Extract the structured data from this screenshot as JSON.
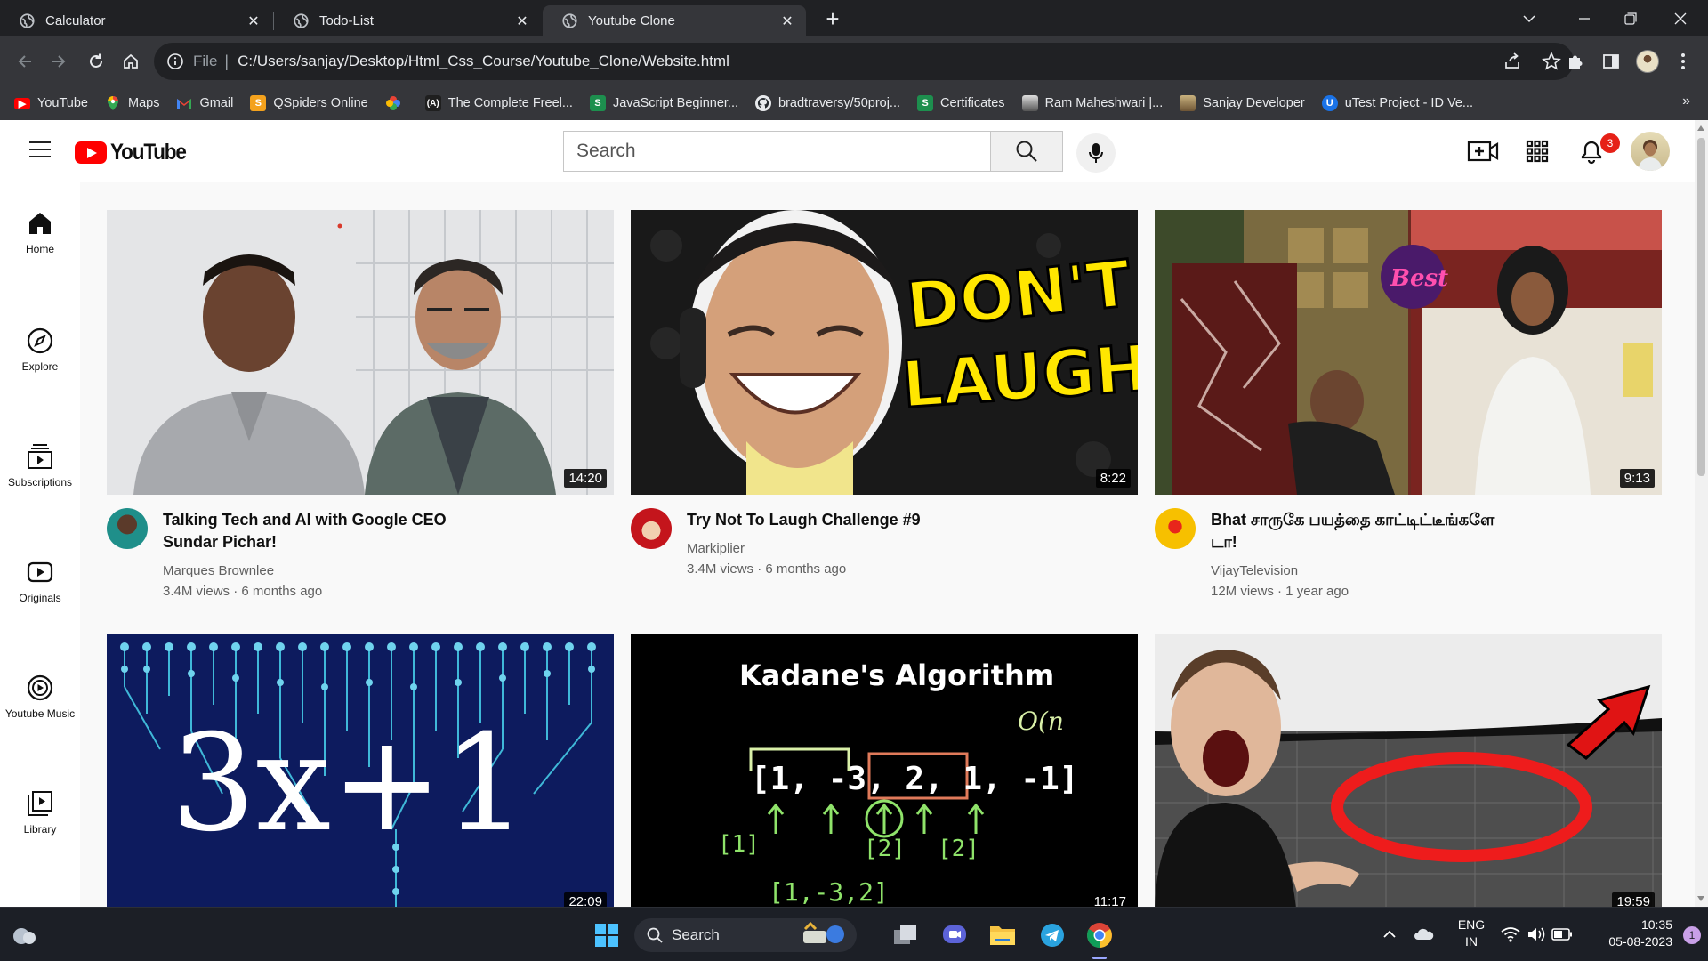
{
  "browser": {
    "tabs": [
      {
        "label": "Calculator",
        "active": false
      },
      {
        "label": "Todo-List",
        "active": false
      },
      {
        "label": "Youtube Clone",
        "active": true
      }
    ],
    "address": {
      "scheme_label": "File",
      "url": "C:/Users/sanjay/Desktop/Html_Css_Course/Youtube_Clone/Website.html"
    },
    "bookmarks": [
      {
        "label": "YouTube",
        "icon": "youtube-icon",
        "color": "#ff0000"
      },
      {
        "label": "Maps",
        "icon": "maps-icon",
        "color": "#34a853"
      },
      {
        "label": "Gmail",
        "icon": "gmail-icon",
        "color": "#ea4335"
      },
      {
        "label": "QSpiders Online",
        "icon": "qspiders-icon",
        "color": "#f4a21d"
      },
      {
        "label": "",
        "icon": "photos-icon",
        "color": "#fbbc04"
      },
      {
        "label": "The Complete Freel...",
        "icon": "freelance-icon",
        "color": "#1f1f1f"
      },
      {
        "label": "JavaScript Beginner...",
        "icon": "udemy-s-icon",
        "color": "#1d8f4e"
      },
      {
        "label": "bradtraversy/50proj...",
        "icon": "github-icon",
        "color": "#24292e"
      },
      {
        "label": "Certificates",
        "icon": "certificates-icon",
        "color": "#1d8f4e"
      },
      {
        "label": "Ram Maheshwari |...",
        "icon": "profile-icon",
        "color": "#6b6b6b"
      },
      {
        "label": "Sanjay Developer",
        "icon": "sanjay-icon",
        "color": "#8a6d4a"
      },
      {
        "label": "uTest Project - ID Ve...",
        "icon": "utest-icon",
        "color": "#1a73e8"
      }
    ],
    "more_label": "»"
  },
  "youtube": {
    "logo_text": "YouTube",
    "search_placeholder": "Search",
    "notification_count": "3",
    "sidebar": [
      {
        "label": "Home",
        "icon": "home-icon"
      },
      {
        "label": "Explore",
        "icon": "explore-icon"
      },
      {
        "label": "Subscriptions",
        "icon": "subscriptions-icon"
      },
      {
        "label": "Originals",
        "icon": "originals-icon"
      },
      {
        "label": "Youtube Music",
        "icon": "youtube-music-icon"
      },
      {
        "label": "Library",
        "icon": "library-icon"
      }
    ],
    "videos": [
      {
        "title": "Talking Tech and AI with Google CEO Sundar Pichar!",
        "channel": "Marques Brownlee",
        "meta": "3.4M views · 6 months ago",
        "duration": "14:20"
      },
      {
        "title": "Try Not To Laugh Challenge #9",
        "channel": "Markiplier",
        "meta": "3.4M views · 6 months ago",
        "duration": "8:22"
      },
      {
        "title": "Bhat சாருகே பயத்தை காட்டிட்டீங்களே டா!",
        "channel": "VijayTelevision",
        "meta": "12M views · 1 year ago",
        "duration": "9:13"
      },
      {
        "title": "",
        "channel": "",
        "meta": "",
        "duration": "22:09"
      },
      {
        "title": "",
        "channel": "",
        "meta": "",
        "duration": "11:17"
      },
      {
        "title": "",
        "channel": "",
        "meta": "",
        "duration": "19:59"
      }
    ],
    "thumb_text": {
      "laugh_line1": "DON'T",
      "laugh_line2": "LAUGH",
      "collatz": "3x+1",
      "kadane_title": "Kadane's Algorithm",
      "kadane_complexity": "O(n",
      "kadane_array": "[1, -3, 2, 1, -1]",
      "kadane_sub1": "[1]",
      "kadane_sub2": "[2]",
      "kadane_sub3": "[1,-3,2]",
      "kadane_sub4": "[2]",
      "show_logo": "Best"
    }
  },
  "taskbar": {
    "search_label": "Search",
    "lang_top": "ENG",
    "lang_bottom": "IN",
    "time": "10:35",
    "date": "05-08-2023",
    "notification_count": "1"
  }
}
